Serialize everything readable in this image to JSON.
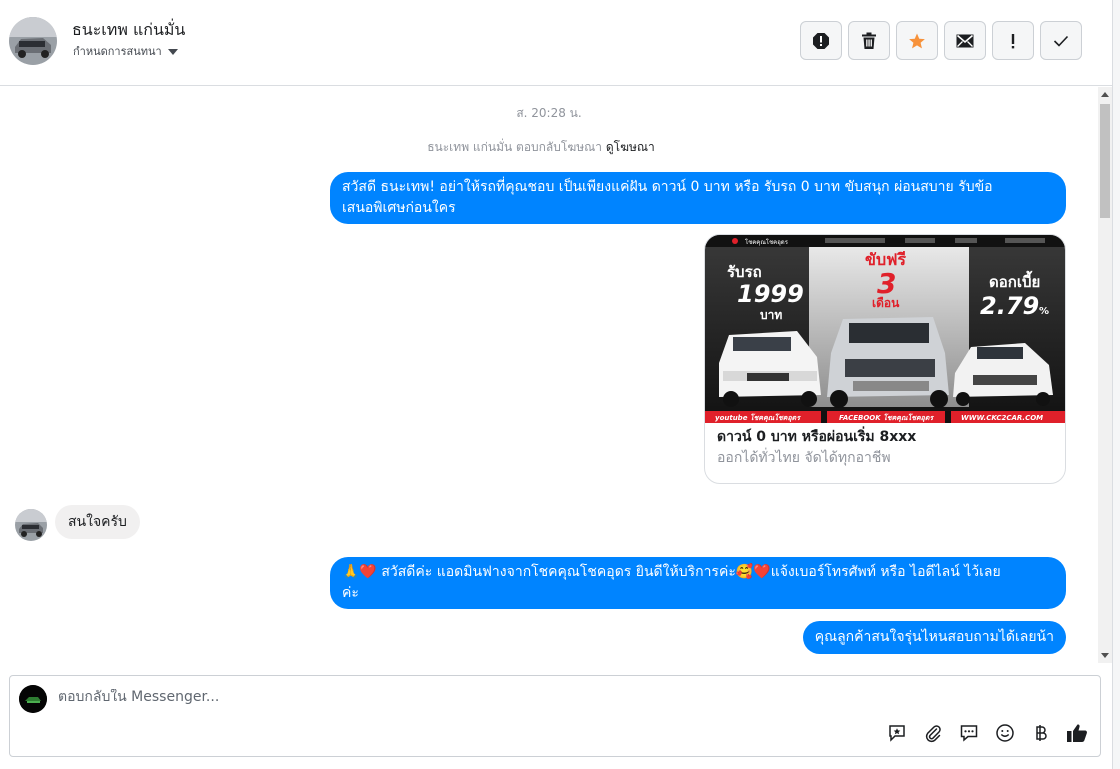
{
  "header": {
    "contact_name": "ธนะเทพ แก่นมั่น",
    "assign_label": "กำหนดการสนทนา"
  },
  "toolbar": {
    "buttons": [
      "spam-icon",
      "trash-icon",
      "star-icon",
      "mail-icon",
      "exclamation-icon",
      "check-icon"
    ],
    "star_color": "#f7923b"
  },
  "thread": {
    "timestamp": "ส. 20:28 น.",
    "ad_reply_text": "ธนะเทพ แก่นมั่น ตอบกลับโฆษณา",
    "ad_reply_link": "ดูโฆษณา",
    "messages": [
      {
        "direction": "out",
        "text_line1": "สวัสดี ธนะเทพ! อย่าให้รถที่คุณชอบ เป็นเพียงแค่ฝัน ดาวน์ 0 บาท หรือ รับรถ 0 บาท ขับสนุก ผ่อนสบาย รับข้อ",
        "text_line2": "เสนอพิเศษก่อนใคร"
      },
      {
        "direction": "in",
        "text": "สนใจครับ"
      },
      {
        "direction": "out",
        "text_line1": "🙏❤️ สวัสดีค่ะ แอดมินฟางจากโชคคุณโชคอุดร ยินดีให้บริการค่ะ🥰❤️แจ้งเบอร์โทรศัพท์ หรือ ไอดีไลน์  ไว้เลย",
        "text_line2": "ค่ะ"
      },
      {
        "direction": "out",
        "text": "คุณลูกค้าสนใจรุ่นไหนสอบถามได้เลยน้า"
      }
    ],
    "ad_card": {
      "banner_top": "โชคคุณโชคอุดร",
      "left_promo_1": "รับรถ",
      "left_promo_2": "1999",
      "left_promo_3": "บาท",
      "center_promo_1": "ขับฟรี",
      "center_promo_2": "3",
      "center_promo_3": "เดือน",
      "right_promo_1": "ดอกเบี้ย",
      "right_promo_2": "2.79",
      "right_promo_3": "%",
      "footer_1": "youtube โชคคุณโชคอุดร",
      "footer_2": "FACEBOOK โชคคุณโชคอุดร",
      "footer_3": "WWW.CKC2CAR.COM",
      "headline": "ดาวน์ 0 บาท หรือผ่อนเริ่ม 8xxx",
      "description": "ออกได้ทั่วไทย จัดได้ทุกอาชีพ"
    }
  },
  "composer": {
    "placeholder": "ตอบกลับใน Messenger..."
  },
  "colors": {
    "messenger_blue": "#0084ff",
    "incoming_gray": "#f1f0f0",
    "promo_red": "#e0202a"
  }
}
